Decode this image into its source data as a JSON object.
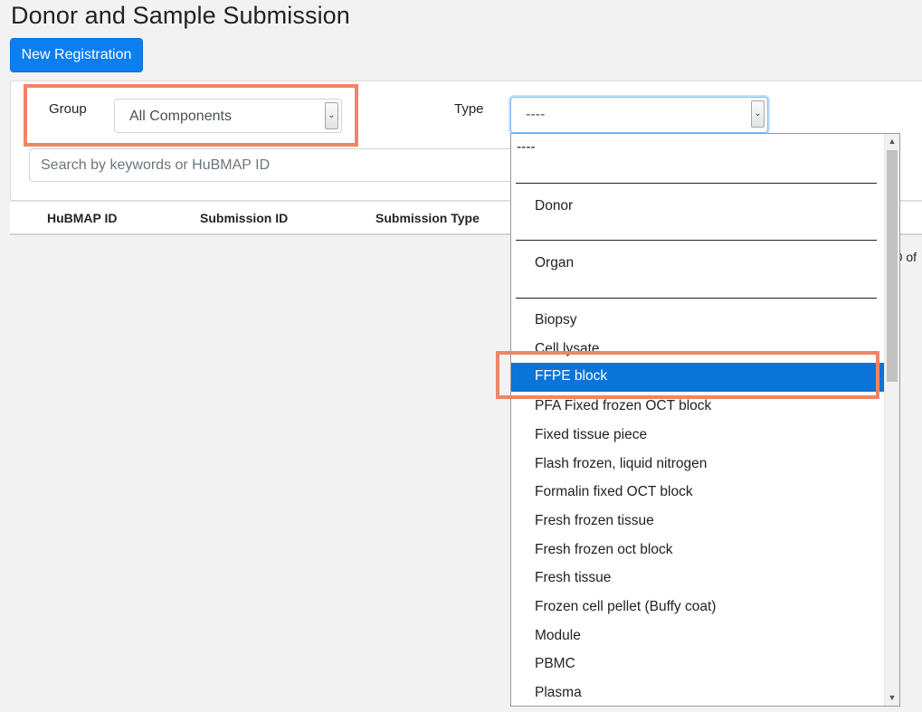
{
  "page": {
    "title": "Donor and Sample Submission",
    "new_button": "New Registration"
  },
  "filters": {
    "group_label": "Group",
    "group_value": "All Components",
    "type_label": "Type",
    "type_value": "----",
    "search_placeholder": "Search by keywords or HuBMAP ID"
  },
  "table": {
    "columns": [
      "HuBMAP ID",
      "Submission ID",
      "Submission Type"
    ],
    "pager_fragment": "-0 of"
  },
  "dropdown": {
    "options": [
      "----",
      "Donor",
      "Organ",
      "Biopsy",
      "Cell lysate",
      "FFPE block",
      "PFA Fixed frozen OCT block",
      "Fixed tissue piece",
      "Flash frozen, liquid nitrogen",
      "Formalin fixed OCT block",
      "Fresh frozen tissue",
      "Fresh frozen oct block",
      "Fresh tissue",
      "Frozen cell pellet (Buffy coat)",
      "Module",
      "PBMC",
      "Plasma"
    ],
    "selected": "FFPE block"
  },
  "icons": {
    "select_arrow": "chevron-down-icon",
    "scroll_up": "scroll-up-arrow-icon",
    "scroll_down": "scroll-down-arrow-icon"
  },
  "colors": {
    "primary": "#0d7ef0",
    "selected_option": "#0a74d8",
    "annotation_highlight": "#ef8563",
    "background": "#f2f2f2"
  }
}
